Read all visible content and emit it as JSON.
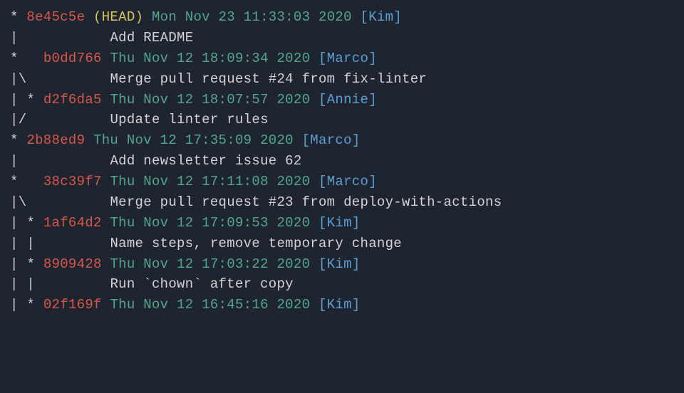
{
  "entries": [
    {
      "graph": "* ",
      "hash": "8e45c5e",
      "head": "(HEAD)",
      "date": "Mon Nov 23 11:33:03 2020",
      "author": "Kim",
      "msgGraph": "|           ",
      "msg": "Add README"
    },
    {
      "graph": "*   ",
      "hash": "b0dd766",
      "head": null,
      "date": "Thu Nov 12 18:09:34 2020",
      "author": "Marco",
      "msgGraph": "|\\          ",
      "msg": "Merge pull request #24 from fix-linter"
    },
    {
      "graph": "| * ",
      "hash": "d2f6da5",
      "head": null,
      "date": "Thu Nov 12 18:07:57 2020",
      "author": "Annie",
      "msgGraph": "|/          ",
      "msg": "Update linter rules"
    },
    {
      "graph": "* ",
      "hash": "2b88ed9",
      "head": null,
      "date": "Thu Nov 12 17:35:09 2020",
      "author": "Marco",
      "msgGraph": "|           ",
      "msg": "Add newsletter issue 62"
    },
    {
      "graph": "*   ",
      "hash": "38c39f7",
      "head": null,
      "date": "Thu Nov 12 17:11:08 2020",
      "author": "Marco",
      "msgGraph": "|\\          ",
      "msg": "Merge pull request #23 from deploy-with-actions"
    },
    {
      "graph": "| * ",
      "hash": "1af64d2",
      "head": null,
      "date": "Thu Nov 12 17:09:53 2020",
      "author": "Kim",
      "msgGraph": "| |         ",
      "msg": "Name steps, remove temporary change"
    },
    {
      "graph": "| * ",
      "hash": "8909428",
      "head": null,
      "date": "Thu Nov 12 17:03:22 2020",
      "author": "Kim",
      "msgGraph": "| |         ",
      "msg": "Run `chown` after copy"
    },
    {
      "graph": "| * ",
      "hash": "02f169f",
      "head": null,
      "date": "Thu Nov 12 16:45:16 2020",
      "author": "Kim",
      "msgGraph": null,
      "msg": null
    }
  ]
}
